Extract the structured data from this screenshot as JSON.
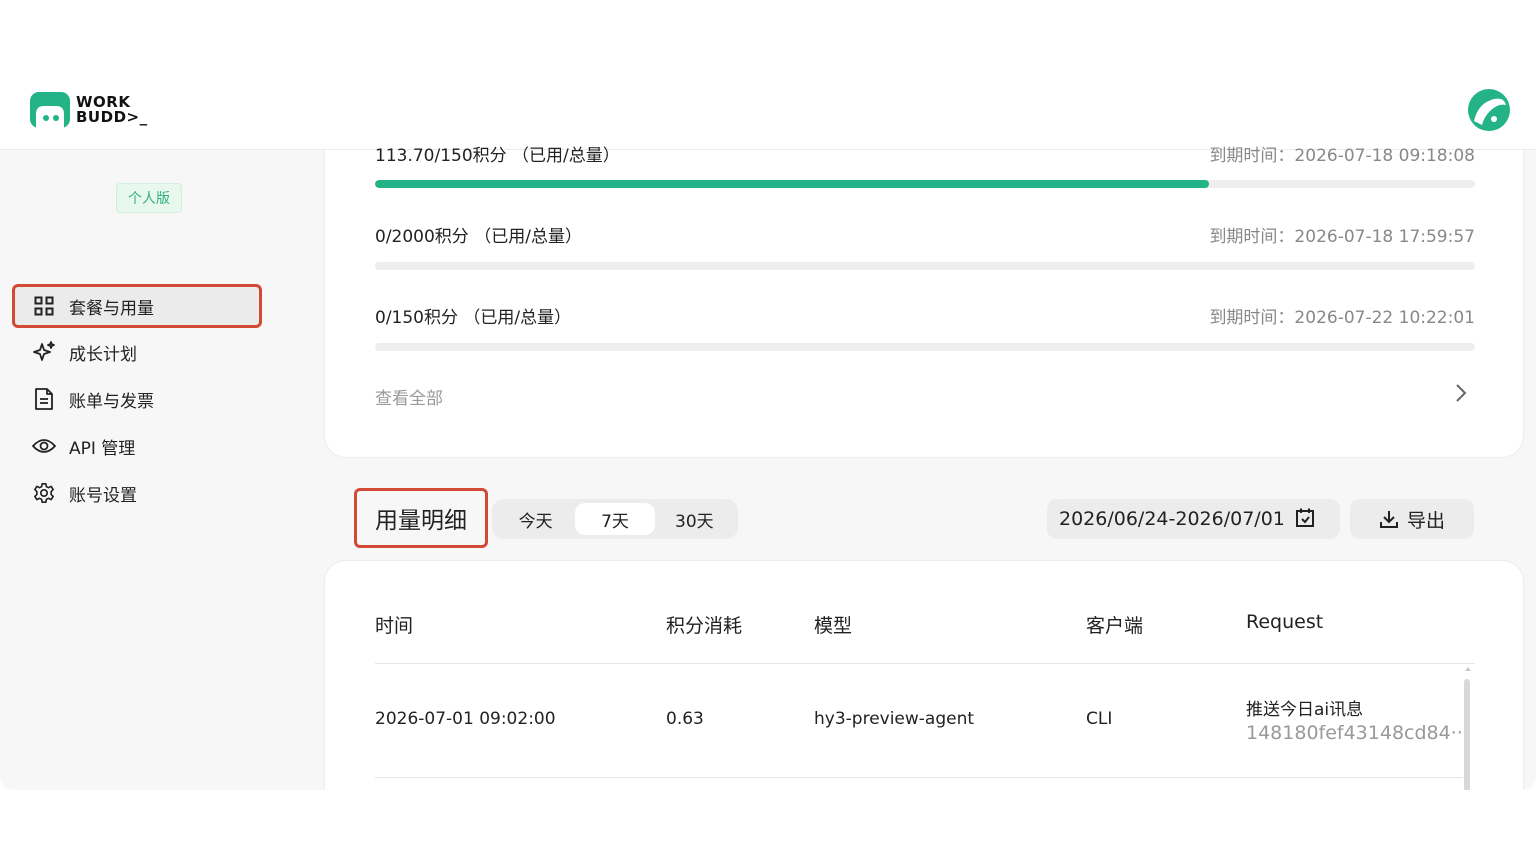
{
  "app": {
    "logo_line1": "WORK",
    "logo_line2": "BUDD>_",
    "brand_color": "#23b387"
  },
  "sidebar": {
    "plan_badge": "个人版",
    "items": [
      {
        "label": "套餐与用量",
        "icon": "grid-icon",
        "active": true
      },
      {
        "label": "成长计划",
        "icon": "sparkle-icon",
        "active": false
      },
      {
        "label": "账单与发票",
        "icon": "document-icon",
        "active": false
      },
      {
        "label": "API 管理",
        "icon": "eye-icon",
        "active": false
      },
      {
        "label": "账号设置",
        "icon": "gear-icon",
        "active": false
      }
    ]
  },
  "quotas": [
    {
      "label": "113.70/150积分 （已用/总量）",
      "expire": "到期时间：2026-07-18 09:18:08",
      "progress": 0.758
    },
    {
      "label": "0/2000积分 （已用/总量）",
      "expire": "到期时间：2026-07-18 17:59:57",
      "progress": 0
    },
    {
      "label": "0/150积分 （已用/总量）",
      "expire": "到期时间：2026-07-22 10:22:01",
      "progress": 0
    }
  ],
  "view_all": "查看全部",
  "usage": {
    "title": "用量明细",
    "ranges": [
      "今天",
      "7天",
      "30天"
    ],
    "selected_range": "7天",
    "date_range": "2026/06/24-2026/07/01",
    "export_label": "导出",
    "columns": [
      "时间",
      "积分消耗",
      "模型",
      "客户端",
      "Request"
    ],
    "rows": [
      {
        "time": "2026-07-01 09:02:00",
        "credits": "0.63",
        "model": "hy3-preview-agent",
        "client": "CLI",
        "request_title": "推送今日ai讯息",
        "request_id": "148180fef43148cd84···"
      }
    ]
  }
}
